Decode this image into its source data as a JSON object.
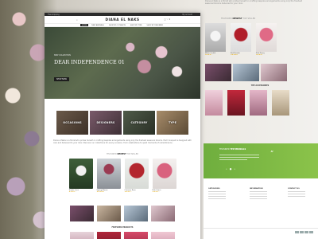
{
  "brand": {
    "logo": "DIANA EL NAKS"
  },
  "topbar": {
    "left_text": "Free shipping",
    "right_text": "My account"
  },
  "nav": {
    "items": [
      "HOME",
      "NEW ARRIVALS",
      "SHOP BY OCCASION",
      "SHOP BY TYPE",
      "SHOP BY DESIGNER"
    ],
    "active_index": 0
  },
  "hero": {
    "kicker": "NEW COLLECTION",
    "title": "DEAR INDEPENDENCE",
    "title_tail": "01",
    "button": "SHOP NOW"
  },
  "categories": [
    "OCCASIONS",
    "DESIGNERS",
    "CATEGORY",
    "TYPE"
  ],
  "intro_text": "Diana el Naks is a florist who prides herself on crafting bespoke arrangements using only the freshest seasonal blooms. Each bouquet is designed with care and delivered to your door. Discover our collections for every occasion, from celebrations to quiet moments of remembrance.",
  "tabs": {
    "prefix": "FEATURED",
    "active": "NEWEST",
    "suffix": "TOP SELLER"
  },
  "products": [
    {
      "name": "Tender Love",
      "stars": "★★★★☆",
      "color": "#3e5f3a"
    },
    {
      "name": "Spring Bloom",
      "stars": "★★★★★",
      "color": "#cfd4d8"
    },
    {
      "name": "Crimson Rose",
      "stars": "★★★★☆",
      "color": "#b3262e"
    },
    {
      "name": "Pink Grace",
      "stars": "★★★★☆",
      "color": "#d9627e"
    }
  ],
  "featured_products_heading": "FEATURED PRODUCTS",
  "right": {
    "tabs": {
      "prefix": "FEATURED",
      "active": "NEWEST",
      "suffix": "TOP SELLER"
    },
    "products": [
      {
        "name": "White Orchid",
        "stars": "★★★★☆"
      },
      {
        "name": "Red Passion",
        "stars": "★★★★★"
      },
      {
        "name": "Pink Peony",
        "stars": "★★★★☆"
      }
    ],
    "feature_heading": "THE ACCESSORIES",
    "testimonial_heading": "FEATURED",
    "testimonial_highlight": "TESTIMONIALS",
    "footer_columns": [
      "CATEGORIES",
      "INFORMATION",
      "CONTACT US"
    ]
  },
  "intro_right": "Diana el Naks is a florist who prides herself on crafting bespoke arrangements using only the freshest seasonal blooms delivered to your door."
}
